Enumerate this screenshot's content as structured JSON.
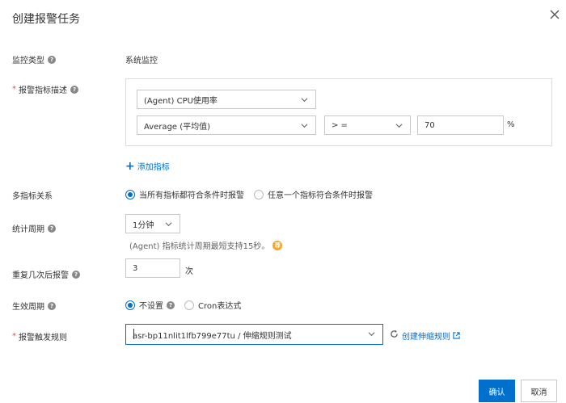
{
  "dialog": {
    "title": "创建报警任务",
    "close_icon": "close-icon"
  },
  "fields": {
    "monitor_type": {
      "label": "监控类型",
      "value": "系统监控"
    },
    "metric_desc": {
      "label": "报警指标描述",
      "metric_select": "(Agent)  CPU使用率",
      "aggregation_select": "Average  (平均值)",
      "operator_select": "> =",
      "threshold_value": "70",
      "unit": "%"
    },
    "add_metric": {
      "label": "添加指标",
      "icon": "plus-icon"
    },
    "multi_metric_relation": {
      "label": "多指标关系",
      "options": [
        "当所有指标都符合条件时报警",
        "任意一个指标符合条件时报警"
      ],
      "selected": 0
    },
    "stat_period": {
      "label": "统计周期",
      "value": "1分钟",
      "hint": "(Agent)  指标统计周期最短支持15秒。",
      "hint_badge": "荐"
    },
    "repeat_alarm": {
      "label": "重复几次后报警",
      "value": "3",
      "unit": "次"
    },
    "effective_period": {
      "label": "生效周期",
      "options": [
        "不设置",
        "Cron表达式"
      ],
      "selected": 0
    },
    "trigger_rule": {
      "label": "报警触发规则",
      "value": "asr-bp11nlit1lfb799e77tu / 伸缩规则测试",
      "create_link": "创建伸缩规则"
    }
  },
  "footer": {
    "confirm_label": "确认",
    "cancel_label": "取消"
  },
  "colors": {
    "accent": "#0070cc",
    "required": "#e84a4a",
    "badge": "#f5a623"
  }
}
